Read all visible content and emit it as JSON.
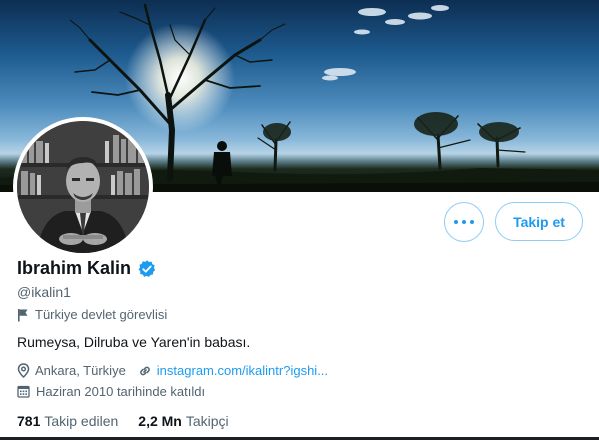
{
  "profile": {
    "name": "Ibrahim Kalin",
    "handle": "@ikalin1",
    "category": "Türkiye devlet görevlisi",
    "bio": "Rumeysa, Dilruba ve Yaren'in babası.",
    "location": "Ankara, Türkiye",
    "website": "instagram.com/ikalintr?igshi...",
    "joined": "Haziran 2010 tarihinde katıldı",
    "following_count": "781",
    "following_label": "Takip edilen",
    "followers_count": "2,2 Mn",
    "followers_label": "Takipçi"
  },
  "actions": {
    "follow_label": "Takip et"
  },
  "icons": {
    "more": "more-dots-icon",
    "verified": "verified-badge-icon",
    "category": "flag-icon",
    "location": "location-pin-icon",
    "website": "link-icon",
    "joined": "calendar-icon"
  },
  "colors": {
    "accent": "#1d9bf0",
    "muted_text": "#536471",
    "primary_text": "#0f1419"
  }
}
